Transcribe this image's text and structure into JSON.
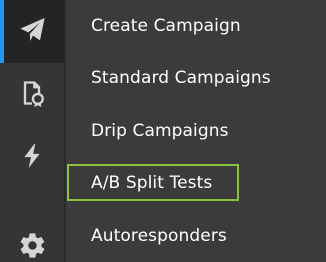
{
  "sidebar": {
    "icons": [
      {
        "name": "paper-plane-icon",
        "active": true
      },
      {
        "name": "report-icon",
        "active": false
      },
      {
        "name": "lightning-icon",
        "active": false
      },
      {
        "name": "gear-icon",
        "active": false
      }
    ]
  },
  "menu": {
    "items": [
      {
        "label": "Create Campaign"
      },
      {
        "label": "Standard Campaigns"
      },
      {
        "label": "Drip Campaigns"
      },
      {
        "label": "A/B Split Tests",
        "highlighted": true
      },
      {
        "label": "Autoresponders"
      }
    ]
  },
  "colors": {
    "accent": "#2196f3",
    "highlight": "#8fc13f",
    "text": "#ffffff",
    "icon": "#d5d5d5",
    "rail_bg": "#353535",
    "active_bg": "#242424",
    "menu_bg": "#3b3b3b"
  }
}
